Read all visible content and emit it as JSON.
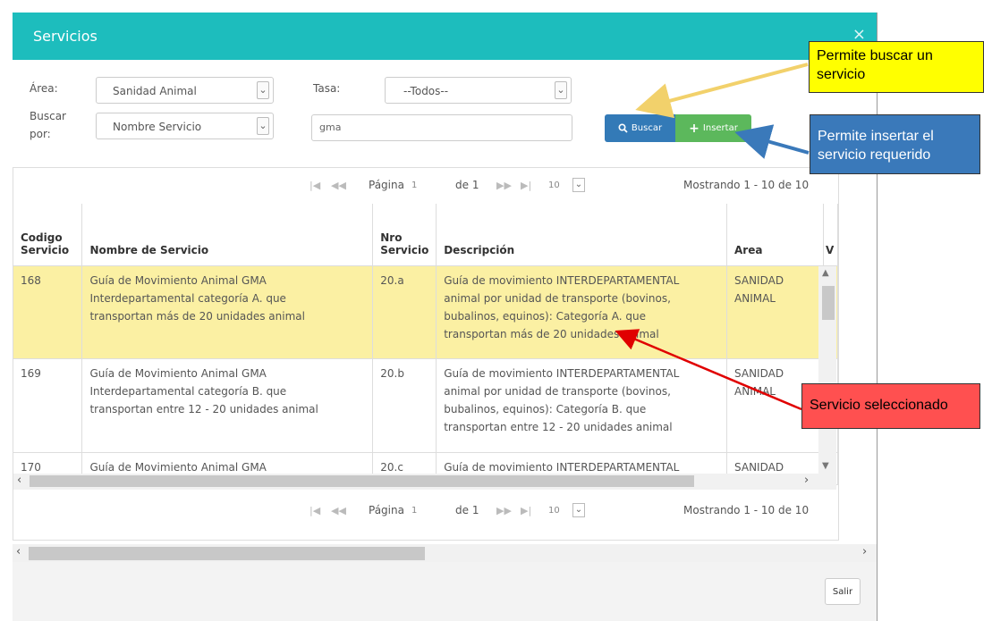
{
  "modal": {
    "title": "Servicios",
    "close_glyph": "×"
  },
  "filters": {
    "area_label": "Área:",
    "area_value": "Sanidad Animal",
    "tasa_label": "Tasa:",
    "tasa_value": "--Todos--",
    "buscar_por_label_1": "Buscar",
    "buscar_por_label_2": "por:",
    "buscar_por_value": "Nombre Servicio",
    "search_text": "gma",
    "buscar_button": "Buscar",
    "insertar_button": "Insertar"
  },
  "pager": {
    "page_label": "Página",
    "page_value": "1",
    "of_label": "de 1",
    "page_size": "10",
    "count_top": "Mostrando 1 - 10 de 10",
    "count_bottom": "Mostrando 1 - 10 de 10"
  },
  "columns": {
    "codigo_1": "Codigo",
    "codigo_2": "Servicio",
    "nombre": "Nombre de Servicio",
    "nro_1": "Nro",
    "nro_2": "Servicio",
    "descripcion": "Descripción",
    "area": "Area",
    "extra": "V"
  },
  "rows": [
    {
      "codigo": "168",
      "nombre_lines": [
        "Guía de Movimiento Animal GMA",
        "Interdepartamental categoría A. que",
        "transportan más de 20 unidades animal"
      ],
      "nro": "20.a",
      "desc_lines": [
        "Guía de movimiento INTERDEPARTAMENTAL",
        "animal por unidad de transporte (bovinos,",
        "bubalinos, equinos): Categoría A. que",
        "transportan más de 20 unidades animal"
      ],
      "area_lines": [
        "SANIDAD",
        "ANIMAL"
      ]
    },
    {
      "codigo": "169",
      "nombre_lines": [
        "Guía de Movimiento Animal GMA",
        "Interdepartamental categoría B. que",
        "transportan entre 12 - 20 unidades animal"
      ],
      "nro": "20.b",
      "desc_lines": [
        "Guía de movimiento INTERDEPARTAMENTAL",
        "animal por unidad de transporte (bovinos,",
        "bubalinos, equinos): Categoría B. que",
        "transportan entre 12 - 20 unidades animal"
      ],
      "area_lines": [
        "SANIDAD",
        "ANIMAL"
      ]
    },
    {
      "codigo": "170",
      "nombre_lines": [
        "Guía de Movimiento Animal GMA"
      ],
      "nro": "20.c",
      "desc_lines": [
        "Guía de movimiento INTERDEPARTAMENTAL"
      ],
      "area_lines": [
        "SANIDAD"
      ]
    }
  ],
  "footer": {
    "salir_button": "Salir"
  },
  "callouts": {
    "buscar_1": "Permite buscar un",
    "buscar_2": "servicio",
    "insertar_1": "Permite insertar el",
    "insertar_2": "servicio requerido",
    "seleccionado": "Servicio seleccionado"
  },
  "colors": {
    "titlebar": "#1dbdbd",
    "buscar_button": "#337ab7",
    "insertar_button": "#5cb85c",
    "selected_row": "#fbf0a3",
    "callout_yellow": "#ffff00",
    "callout_blue": "#3a79ba",
    "callout_red": "#ff5050"
  }
}
